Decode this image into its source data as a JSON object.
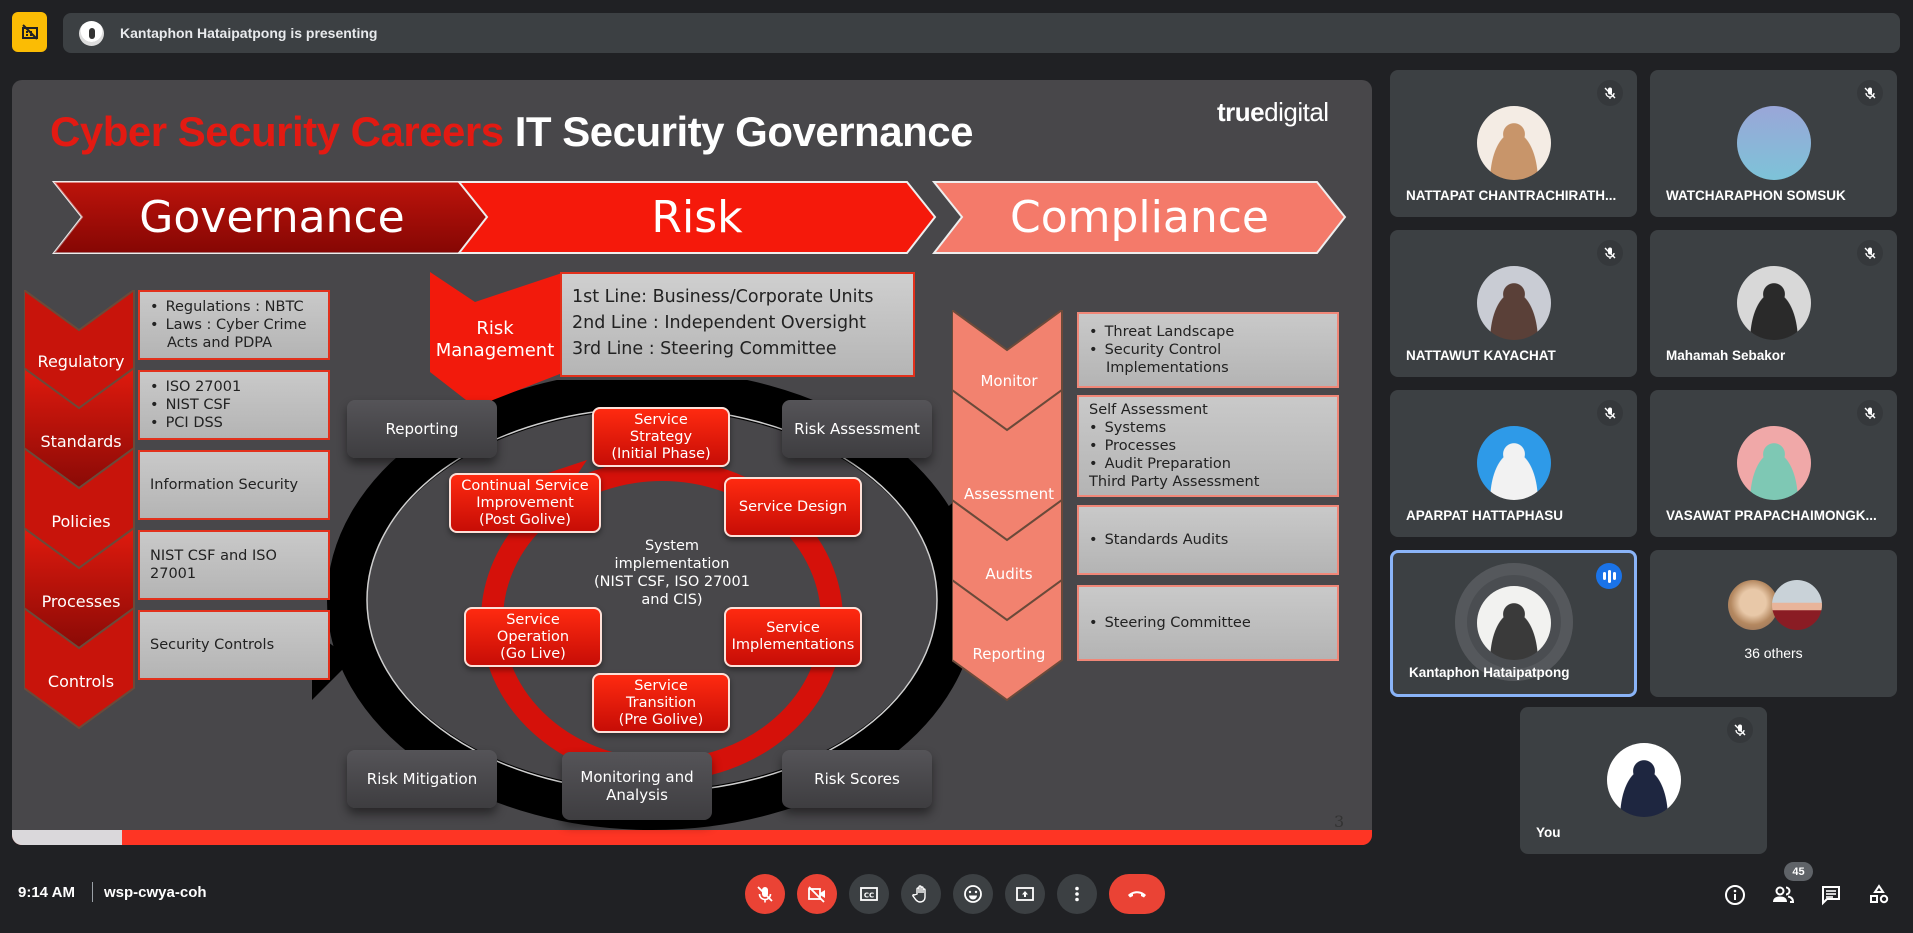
{
  "top_bar": {
    "presenting_text": "Kantaphon Hataipatpong is presenting",
    "badge_icon": "presentation-off-icon"
  },
  "slide": {
    "title_red": "Cyber Security Careers",
    "title_white": "IT Security Governance",
    "logo_bold": "true",
    "logo_thin": "digital",
    "banners": [
      "Governance",
      "Risk",
      "Compliance"
    ],
    "governance": [
      {
        "label": "Regulatory",
        "lines": [
          {
            "bullet": true,
            "text": "Regulations : NBTC"
          },
          {
            "bullet": true,
            "text": "Laws : Cyber Crime"
          },
          {
            "bullet": false,
            "text": "Acts and PDPA"
          }
        ]
      },
      {
        "label": "Standards",
        "lines": [
          {
            "bullet": true,
            "text": "ISO 27001"
          },
          {
            "bullet": true,
            "text": "NIST CSF"
          },
          {
            "bullet": true,
            "text": "PCI DSS"
          }
        ]
      },
      {
        "label": "Policies",
        "lines": [
          {
            "bullet": false,
            "text": "Information Security"
          }
        ]
      },
      {
        "label": "Processes",
        "lines": [
          {
            "bullet": false,
            "text": "NIST CSF and  ISO"
          },
          {
            "bullet": false,
            "text": "27001"
          }
        ]
      },
      {
        "label": "Controls",
        "lines": [
          {
            "bullet": false,
            "text": "Security Controls"
          }
        ]
      }
    ],
    "risk_management": {
      "label": "Risk\nManagement",
      "lines": [
        "1st Line: Business/Corporate Units",
        "2nd Line : Independent Oversight",
        "3rd Line : Steering Committee"
      ]
    },
    "risk_cycle": [
      "Reporting",
      "Risk Assessment",
      "Risk Scores",
      "Monitoring and\nAnalysis",
      "Risk Mitigation"
    ],
    "service_cycle": [
      "Service\nStrategy\n(Initial Phase)",
      "Service Design",
      "Service\nImplementations",
      "Service\nTransition\n(Pre Golive)",
      "Service\nOperation\n(Go Live)",
      "Continual Service\nImprovement\n(Post Golive)"
    ],
    "center_text": "System\nimplementation\n(NIST CSF, ISO 27001\nand CIS)",
    "compliance": [
      {
        "label": "Monitor",
        "lines": [
          {
            "bullet": true,
            "text": "Threat Landscape"
          },
          {
            "bullet": true,
            "text": "Security Control"
          },
          {
            "bullet": false,
            "cont": true,
            "text": "Implementations"
          }
        ]
      },
      {
        "label": "Assessment",
        "lines": [
          {
            "bullet": false,
            "text": "Self Assessment"
          },
          {
            "bullet": true,
            "text": "Systems"
          },
          {
            "bullet": true,
            "text": "Processes"
          },
          {
            "bullet": true,
            "text": "Audit Preparation"
          },
          {
            "bullet": false,
            "text": "Third Party Assessment"
          }
        ]
      },
      {
        "label": "Audits",
        "lines": [
          {
            "bullet": true,
            "text": "Standards Audits"
          }
        ]
      },
      {
        "label": "Reporting",
        "lines": [
          {
            "bullet": true,
            "text": "Steering Committee"
          }
        ]
      }
    ],
    "page_number": "3",
    "progress_fraction": 0.081
  },
  "participants": [
    {
      "name": "NATTAPAT CHANTRACHIRATH...",
      "muted": true,
      "avatar": "cat-photo",
      "colors": [
        "#f4ece4",
        "#c8956a"
      ]
    },
    {
      "name": "WATCHARAPHON SOMSUK",
      "muted": true,
      "avatar": "gradient",
      "colors": [
        "#9aa6d8",
        "#7dc3d8"
      ]
    },
    {
      "name": "NATTAWUT KAYACHAT",
      "muted": true,
      "avatar": "dog-photo",
      "colors": [
        "#c9ccd4",
        "#5a4038"
      ]
    },
    {
      "name": "Mahamah Sebakor",
      "muted": true,
      "avatar": "person-photo",
      "colors": [
        "#d8d8d8",
        "#2a2a2a"
      ]
    },
    {
      "name": "APARPAT HATTAPHASU",
      "muted": true,
      "avatar": "person-photo",
      "colors": [
        "#2e9ae8",
        "#f2f2f2"
      ]
    },
    {
      "name": "VASAWAT PRAPACHAIMONGK...",
      "muted": true,
      "avatar": "anime-photo",
      "colors": [
        "#f0a8a8",
        "#7ec8b4"
      ]
    },
    {
      "name": "Kantaphon Hataipatpong",
      "muted": false,
      "speaking": true,
      "active": true,
      "avatar": "person-photo",
      "colors": [
        "#f2f2f0",
        "#3a3a3a"
      ]
    },
    {
      "name": "36 others",
      "others": true
    },
    {
      "name": "You",
      "muted": true,
      "avatar": "person-photo",
      "colors": [
        "#ffffff",
        "#1e2640"
      ]
    }
  ],
  "bottom_bar": {
    "time": "9:14 AM",
    "meeting_code": "wsp-cwya-coh",
    "controls": [
      "mic-off-icon",
      "camera-off-icon",
      "captions-icon",
      "raise-hand-icon",
      "emoji-icon",
      "present-screen-icon",
      "more-options-icon",
      "end-call-icon"
    ],
    "people_count": "45",
    "right_controls": [
      "info-icon",
      "people-icon",
      "chat-icon",
      "activities-icon"
    ]
  },
  "colors": {
    "accent": "#8ab4f8",
    "danger": "#ea4335",
    "badge": "#fbbc04",
    "slide_red": "#e31a12"
  }
}
